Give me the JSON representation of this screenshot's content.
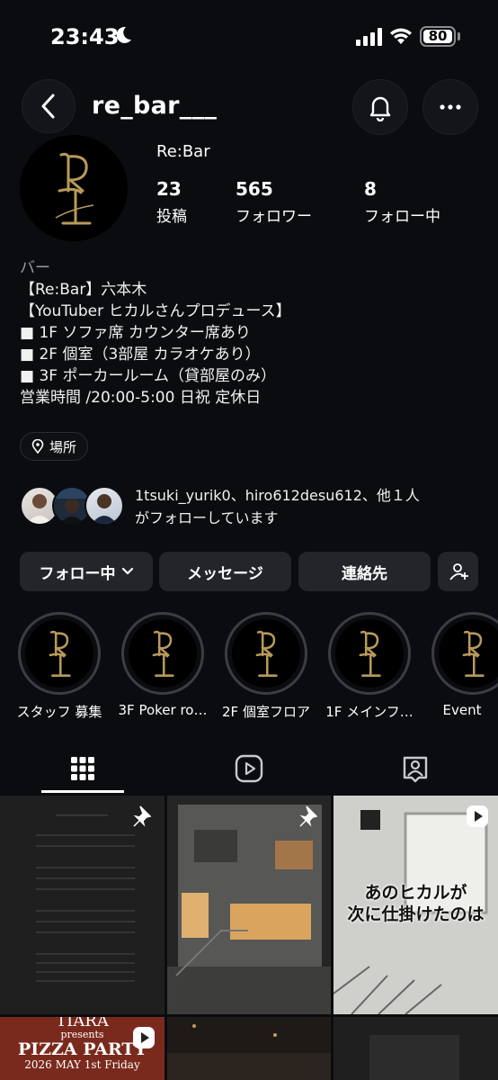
{
  "status": {
    "time": "23:43",
    "battery": "80"
  },
  "header": {
    "handle": "re_bar___"
  },
  "profile": {
    "display_name": "Re:Bar",
    "stats": [
      {
        "value": "23",
        "label": "投稿"
      },
      {
        "value": "565",
        "label": "フォロワー"
      },
      {
        "value": "8",
        "label": "フォロー中"
      }
    ],
    "category": "バー",
    "bio_lines": [
      "【Re:Bar】六本木",
      "【YouTuber ヒカルさんプロデュース】",
      "■ 1F ソファ席 カウンター席あり",
      "■ 2F 個室（3部屋 カラオケあり）",
      "■ 3F ポーカールーム（貸部屋のみ）",
      "営業時間 /20:00-5:00 日祝 定休日"
    ],
    "location_label": "場所",
    "followed_by_line1": "1tsuki_yurik0、hiro612desu612、他１人",
    "followed_by_line2": "がフォローしています"
  },
  "actions": {
    "following": "フォロー中",
    "message": "メッセージ",
    "contact": "連絡先"
  },
  "highlights": [
    {
      "label": "スタッフ 募集"
    },
    {
      "label": "3F Poker ro…"
    },
    {
      "label": "2F 個室フロア"
    },
    {
      "label": "1F メインフ…"
    },
    {
      "label": "Event"
    }
  ],
  "posts": {
    "post2_overlay_line1": "あのヒカルが",
    "post2_overlay_line2": "次に仕掛けたのは",
    "post3_brand": "TIARA",
    "post3_presents": "presents",
    "post3_title": "PIZZA PARTY",
    "post3_date": "2026 MAY 1st Friday"
  },
  "colors": {
    "background": "#0b0c10",
    "button": "#24252b",
    "accent_gold": "#b89a5a"
  }
}
